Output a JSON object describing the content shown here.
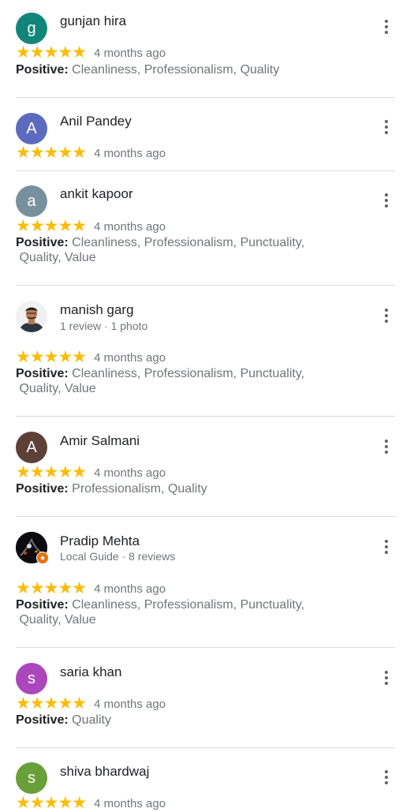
{
  "positive_label": "Positive:",
  "reviews": [
    {
      "name": "gunjan hira",
      "initial": "g",
      "avatar_color": "#12857a",
      "rating": "★★★★★",
      "time": "4 months ago",
      "positive": "Cleanliness, Professionalism, Quality"
    },
    {
      "name": "Anil Pandey",
      "initial": "A",
      "avatar_color": "#5c6bc0",
      "rating": "★★★★★",
      "time": "4 months ago"
    },
    {
      "name": "ankit kapoor",
      "initial": "a",
      "avatar_color": "#78909c",
      "rating": "★★★★★",
      "time": "4 months ago",
      "positive_line1": "Cleanliness, Professionalism, Punctuality,",
      "positive_line2": "Quality, Value"
    },
    {
      "name": "manish garg",
      "sub": "1 review · 1 photo",
      "rating": "★★★★★",
      "time": "4 months ago",
      "positive_line1": "Cleanliness, Professionalism, Punctuality,",
      "positive_line2": "Quality, Value"
    },
    {
      "name": "Amir Salmani",
      "initial": "A",
      "avatar_color": "#5d4037",
      "rating": "★★★★★",
      "time": "4 months ago",
      "positive": "Professionalism, Quality"
    },
    {
      "name": "Pradip Mehta",
      "sub": "Local Guide · 8 reviews",
      "rating": "★★★★★",
      "time": "4 months ago",
      "positive_line1": "Cleanliness, Professionalism, Punctuality,",
      "positive_line2": "Quality, Value"
    },
    {
      "name": "saria khan",
      "initial": "s",
      "avatar_color": "#ab47bc",
      "rating": "★★★★★",
      "time": "4 months ago",
      "positive": "Quality"
    },
    {
      "name": "shiva bhardwaj",
      "initial": "s",
      "avatar_color": "#689f38",
      "rating": "★★★★★",
      "time": "4 months ago"
    }
  ]
}
